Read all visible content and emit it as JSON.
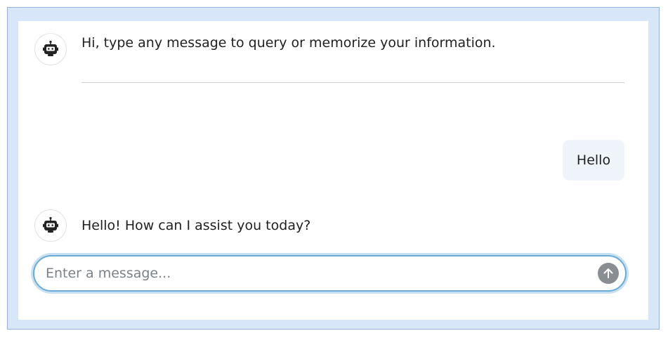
{
  "chat": {
    "messages": [
      {
        "role": "bot",
        "text": "Hi, type any message to query or memorize your information.",
        "avatar_icon": "robot-icon"
      },
      {
        "role": "user",
        "text": "Hello"
      },
      {
        "role": "bot",
        "text": "Hello! How can I assist you today?",
        "avatar_icon": "robot-icon"
      }
    ]
  },
  "composer": {
    "placeholder": "Enter a message...",
    "value": "",
    "send_icon": "arrow-up-icon"
  },
  "colors": {
    "frame_bg": "#d8e6fa",
    "frame_border": "#97b3dc",
    "user_bubble_bg": "#eef4f9",
    "input_focus_border": "#6aaad6",
    "send_button_bg": "#8a8d91"
  }
}
